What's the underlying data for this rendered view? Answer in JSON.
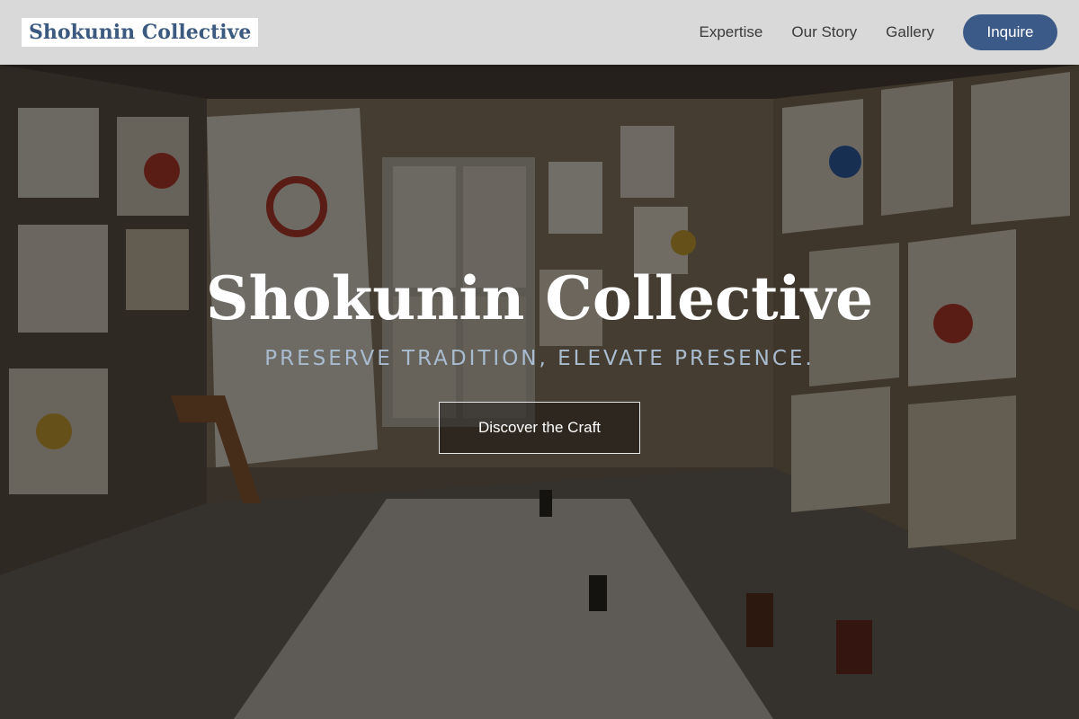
{
  "header": {
    "logo_text": "Shokunin Collective",
    "nav": [
      {
        "label": "Expertise"
      },
      {
        "label": "Our Story"
      },
      {
        "label": "Gallery"
      }
    ],
    "cta_label": "Inquire"
  },
  "hero": {
    "title": "Shokunin Collective",
    "tagline": "PRESERVE TRADITION, ELEVATE PRESENCE.",
    "button_label": "Discover the Craft",
    "background_description_icon": "art-studio-photo"
  },
  "colors": {
    "brand_blue": "#3c5a80",
    "cta_blue": "#3c5a87",
    "tagline": "#a9bccf"
  }
}
